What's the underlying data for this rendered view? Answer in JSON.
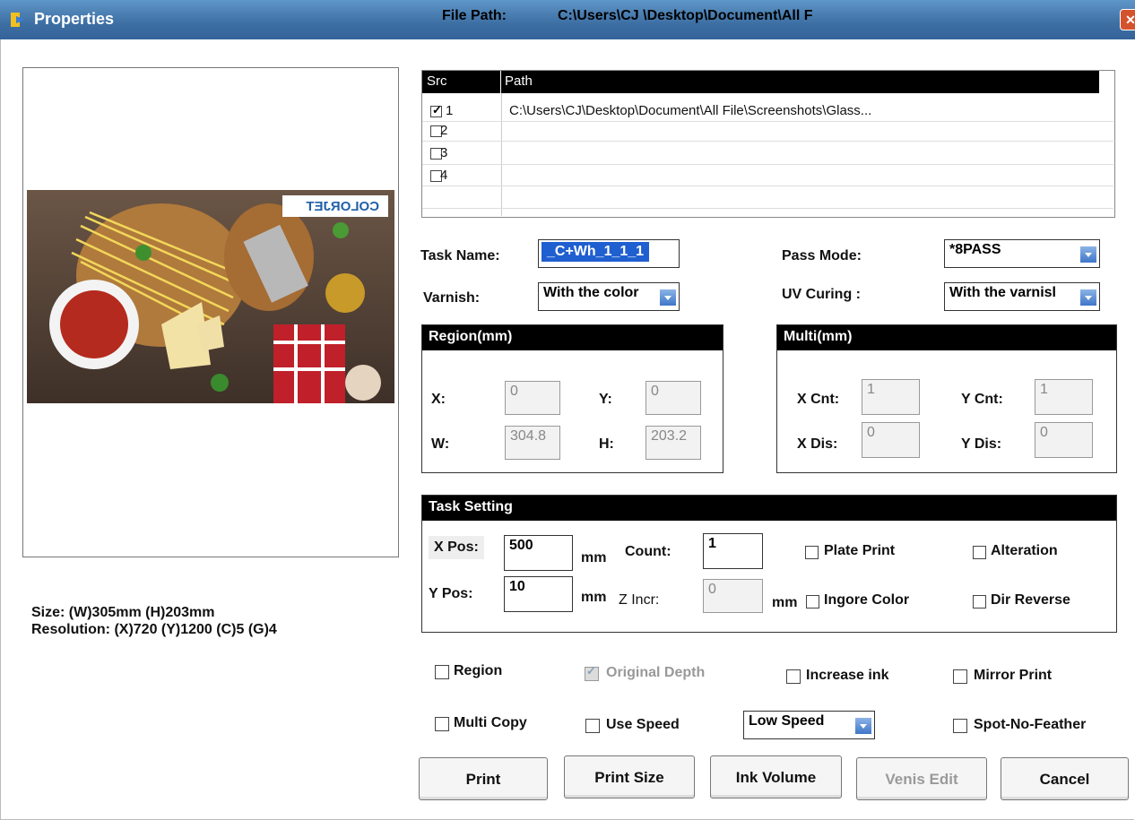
{
  "window": {
    "title": "Properties",
    "file_path_label": "File Path:",
    "file_path_value": "C:\\Users\\CJ \\Desktop\\Document\\All F",
    "close_glyph": "✕"
  },
  "preview": {
    "logo_text": "COLORJET",
    "size_text": "Size: (W)305mm (H)203mm",
    "resolution_text": "Resolution: (X)720  (Y)1200 (C)5 (G)4"
  },
  "source_table": {
    "headers": [
      "Src",
      "Path"
    ],
    "rows": [
      {
        "src": "1",
        "checked": true,
        "path": "C:\\Users\\CJ\\Desktop\\Document\\All File\\Screenshots\\Glass..."
      },
      {
        "src": "2",
        "checked": false,
        "path": ""
      },
      {
        "src": "3",
        "checked": false,
        "path": ""
      },
      {
        "src": "4",
        "checked": false,
        "path": ""
      }
    ]
  },
  "task": {
    "task_name_label": "Task Name:",
    "task_name_value": "_C+Wh_1_1_1",
    "pass_mode_label": "Pass Mode:",
    "pass_mode_value": "*8PASS",
    "varnish_label": "Varnish:",
    "varnish_value": "With the color",
    "uv_curing_label": "UV Curing :",
    "uv_curing_value": "With the varnisl"
  },
  "region": {
    "title": "Region(mm)",
    "x_label": "X:",
    "x_value": "0",
    "y_label": "Y:",
    "y_value": "0",
    "w_label": "W:",
    "w_value": "304.8",
    "h_label": "H:",
    "h_value": "203.2"
  },
  "multi": {
    "title": "Multi(mm)",
    "x_cnt_label": "X Cnt:",
    "x_cnt_value": "1",
    "y_cnt_label": "Y Cnt:",
    "y_cnt_value": "1",
    "x_dis_label": "X Dis:",
    "x_dis_value": "0",
    "y_dis_label": "Y Dis:",
    "y_dis_value": "0"
  },
  "task_setting": {
    "title": "Task Setting",
    "x_pos_label": "X Pos:",
    "x_pos_value": "500",
    "y_pos_label": "Y Pos:",
    "y_pos_value": "10",
    "mm1": "mm",
    "mm2": "mm",
    "mm3": "mm",
    "count_label": "Count:",
    "count_value": "1",
    "z_incr_label": "Z Incr:",
    "z_incr_value": "0",
    "plate_print": "Plate Print",
    "alteration": "Alteration",
    "ignore_color": "Ingore Color",
    "dir_reverse": "Dir Reverse"
  },
  "options": {
    "region": "Region",
    "original_depth": "Original Depth",
    "increase_ink": "Increase ink",
    "mirror_print": "Mirror Print",
    "multi_copy": "Multi Copy",
    "use_speed": "Use Speed",
    "speed_value": "Low Speed",
    "spot_no_feather": "Spot-No-Feather"
  },
  "buttons": {
    "print": "Print",
    "print_size": "Print Size",
    "ink_volume": "Ink Volume",
    "venis_edit": "Venis Edit",
    "cancel": "Cancel"
  }
}
